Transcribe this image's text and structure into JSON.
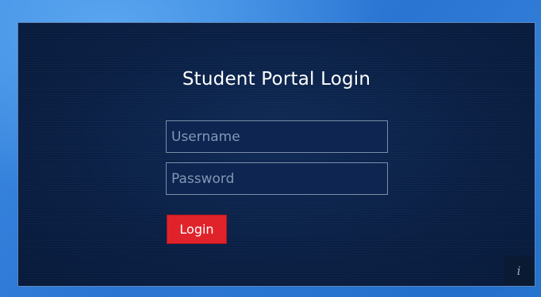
{
  "login": {
    "title": "Student Portal Login",
    "username_placeholder": "Username",
    "password_placeholder": "Password",
    "login_label": "Login"
  },
  "info": {
    "label": "i",
    "icon": "info-icon"
  },
  "colors": {
    "desktop_background": "#2f7fdc",
    "panel_background": "#0a1f44",
    "login_button": "#e0232a",
    "field_border": "#7b8ea8",
    "title_text": "#ffffff"
  }
}
